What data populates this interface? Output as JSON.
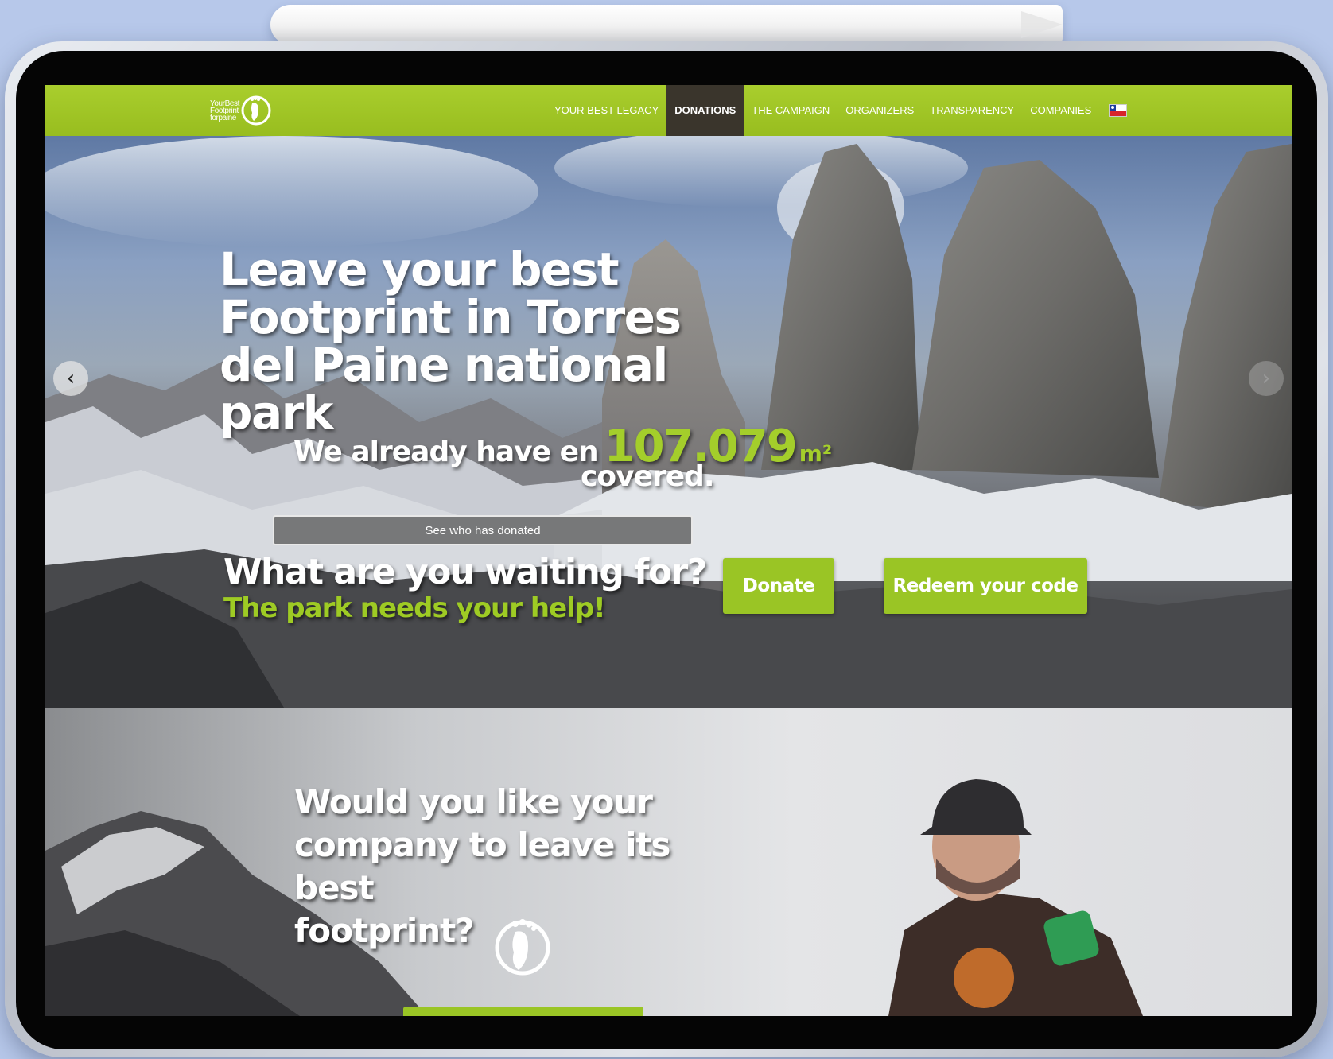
{
  "nav": {
    "logo_text": [
      "YourBest",
      "Footprint",
      "forpaine"
    ],
    "items": [
      {
        "label": "YOUR BEST LEGACY",
        "active": false
      },
      {
        "label": "DONATIONS",
        "active": true
      },
      {
        "label": "THE CAMPAIGN",
        "active": false
      },
      {
        "label": "ORGANIZERS",
        "active": false
      },
      {
        "label": "TRANSPARENCY",
        "active": false
      },
      {
        "label": "COMPANIES",
        "active": false
      }
    ],
    "flag_icon": "chile-flag-icon"
  },
  "hero": {
    "title_lines": [
      "Leave your best",
      "Footprint in Torres",
      "del Paine national park"
    ],
    "stat_prefix": "We already have en",
    "stat_value": "107.079",
    "stat_unit": "m²",
    "stat_suffix": "covered.",
    "donors_button": "See who has donated",
    "cta_question": "What are you waiting for?",
    "cta_help": "The park needs your help!",
    "donate_button": "Donate",
    "redeem_button": "Redeem your code",
    "prev_icon": "chevron-left-icon",
    "next_icon": "chevron-right-icon"
  },
  "companies": {
    "title_lines": [
      "Would you like your",
      "company to leave its best",
      "footprint?"
    ],
    "logo_icon": "footprint-logo-icon"
  },
  "colors": {
    "brand_green": "#9ac525",
    "nav_active": "#3a352c",
    "accent_text": "#a4ce2b"
  }
}
